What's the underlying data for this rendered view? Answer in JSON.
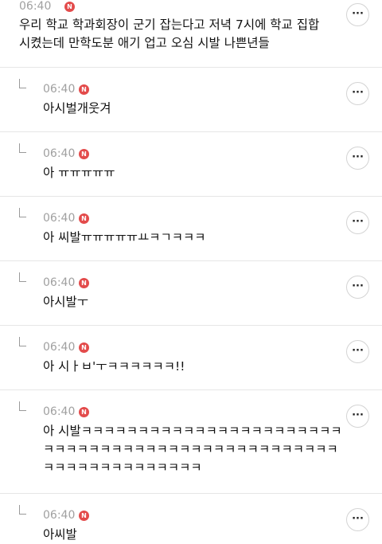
{
  "posts": [
    {
      "time": "06:40",
      "badge": "N",
      "text": "우리 학교 학과회장이 군기 잡는다고 저녁 7시에 학교 집합\n시켰는데 만학도분 애기 업고 오심 시발 나쁜년들",
      "more": "···"
    },
    {
      "time": "06:40",
      "badge": "N",
      "text": "아시벌개웃겨",
      "more": "···"
    },
    {
      "time": "06:40",
      "badge": "N",
      "text": "아 ㅠㅠㅠㅠㅠ",
      "more": "···"
    },
    {
      "time": "06:40",
      "badge": "N",
      "text": "아 씨발ㅠㅠㅠㅠㅠㅛㅋㄱㅋㅋㅋ",
      "more": "···"
    },
    {
      "time": "06:40",
      "badge": "N",
      "text": "아시발ㅜ",
      "more": "···"
    },
    {
      "time": "06:40",
      "badge": "N",
      "text": "아 시ㅏㅂ'ㅜㅋㅋㅋㅋㅋㅋ!!",
      "more": "···"
    },
    {
      "time": "06:40",
      "badge": "N",
      "text": "아 시발ㅋㅋㅋㅋㅋㅋㅋㅋㅋㅋㅋㅋㅋㅋㅋㅋㅋㅋㅋㅋㅋㅋㅋ\nㅋㅋㅋㅋㅋㅋㅋㅋㅋㅋㅋㅋㅋㅋㅋㅋㅋㅋㅋㅋㅋㅋㅋㅋㅋㅋ\nㅋㅋㅋㅋㅋㅋㅋㅋㅋㅋㅋㅋㅋㅋ",
      "more": "···"
    },
    {
      "time": "06:40",
      "badge": "N",
      "text": "아씨발",
      "more": "···"
    }
  ],
  "colors": {
    "badge": "#e34b4b",
    "time": "#a0a0a0",
    "divider": "#e6e6e6"
  }
}
